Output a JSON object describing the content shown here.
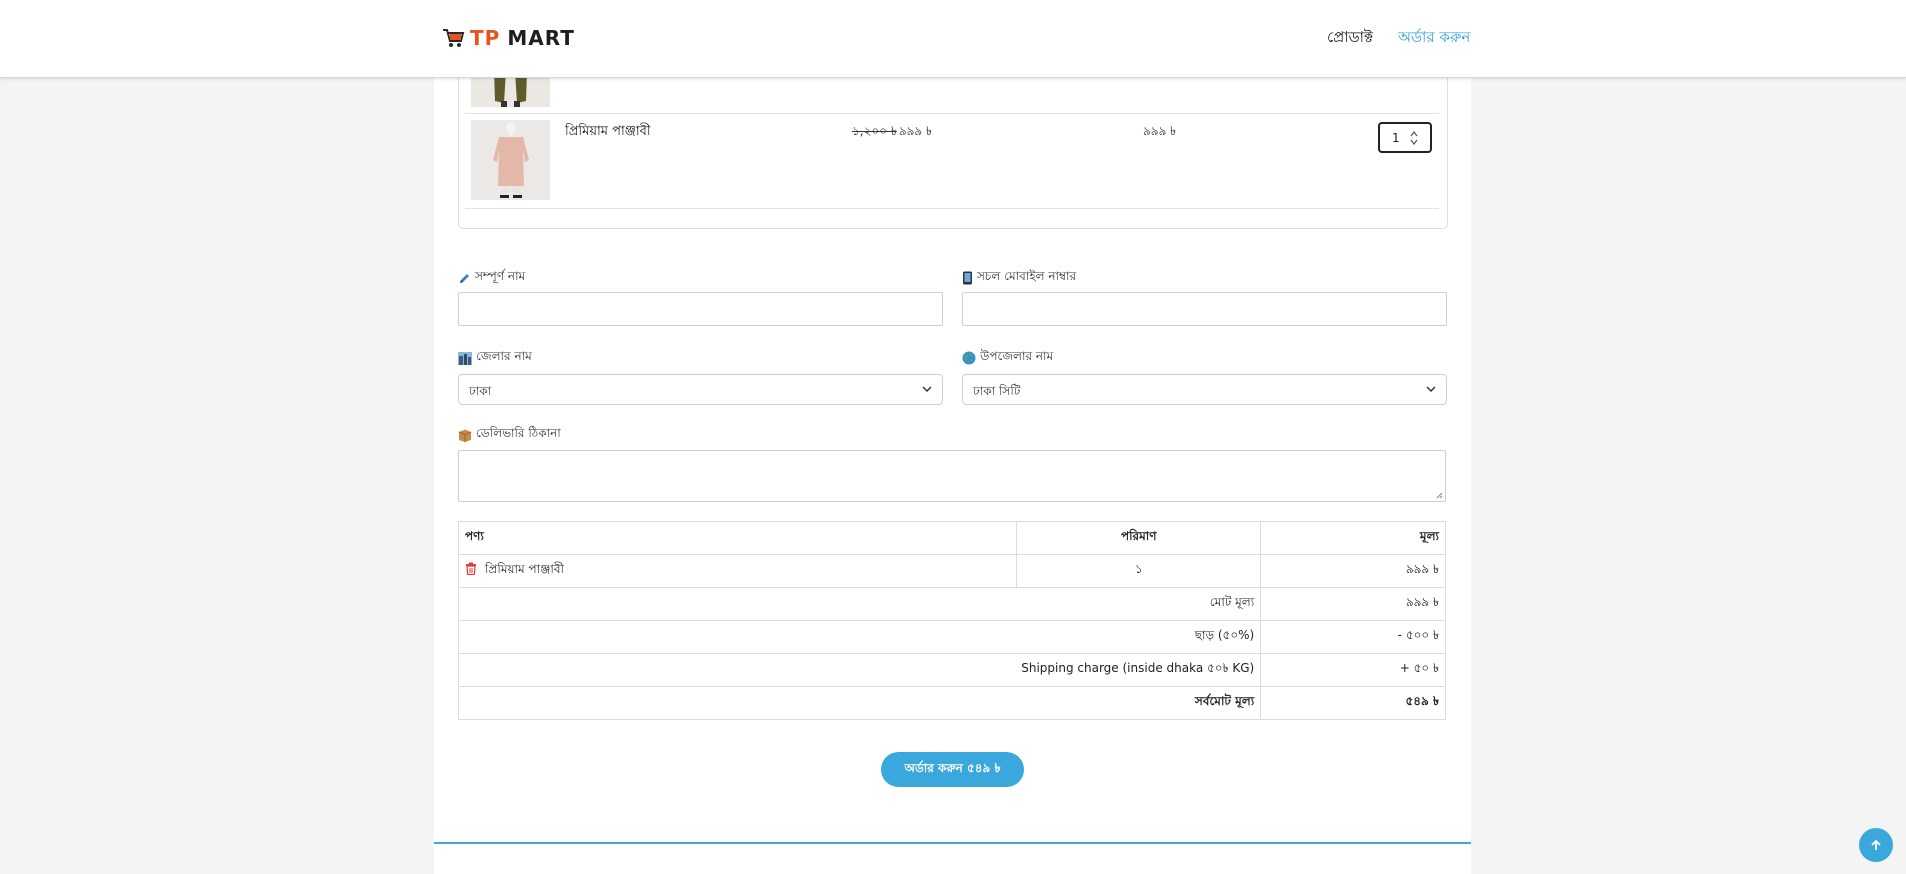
{
  "header": {
    "logo_tp": "TP",
    "logo_mart": "MART",
    "nav_products": "প্রোডাক্ট",
    "nav_order": "অর্ডার করুন"
  },
  "cart": {
    "items": [
      {
        "name": "প্রিমিয়াম পাঞ্জাবী",
        "price_old": "১,২০০ ৳",
        "price_new": "৯৯৯ ৳",
        "line_total": "৯৯৯ ৳",
        "quantity": "1"
      }
    ]
  },
  "form": {
    "full_name_label": "সম্পূর্ণ নাম",
    "mobile_label": "সচল মোবাইল নাম্বার",
    "district_label": "জেলার নাম",
    "district_value": "ঢাকা",
    "upazila_label": "উপজেলার নাম",
    "upazila_value": "ঢাকা সিটি",
    "address_label": "ডেলিভারি ঠিকানা",
    "full_name_icon": "pencil-icon",
    "mobile_icon": "mobile-phone-icon",
    "district_icon": "city-icon",
    "upazila_icon": "globe-icon",
    "address_icon": "package-icon"
  },
  "summary": {
    "col_product": "পণ্য",
    "col_quantity": "পরিমাণ",
    "col_price": "মূল্য",
    "item_name": "প্রিমিয়াম পাঞ্জাবী",
    "item_qty": "১",
    "item_price": "৯৯৯ ৳",
    "subtotal_label": "মোট মূল্য",
    "subtotal_value": "৯৯৯ ৳",
    "discount_label": "ছাড় (৫০%)",
    "discount_value": "- ৫০০ ৳",
    "shipping_label": "Shipping charge (inside dhaka ৫০৳ KG)",
    "shipping_value": "+ ৫০ ৳",
    "grand_total_label": "সর্বমোট মূল্য",
    "grand_total_value": "৫৪৯ ৳"
  },
  "order_button": "অর্ডার করুন ৫৪৯ ৳",
  "colors": {
    "accent": "#3aa8dd",
    "logo_orange": "#e8541e",
    "trash_red": "#e53935"
  }
}
